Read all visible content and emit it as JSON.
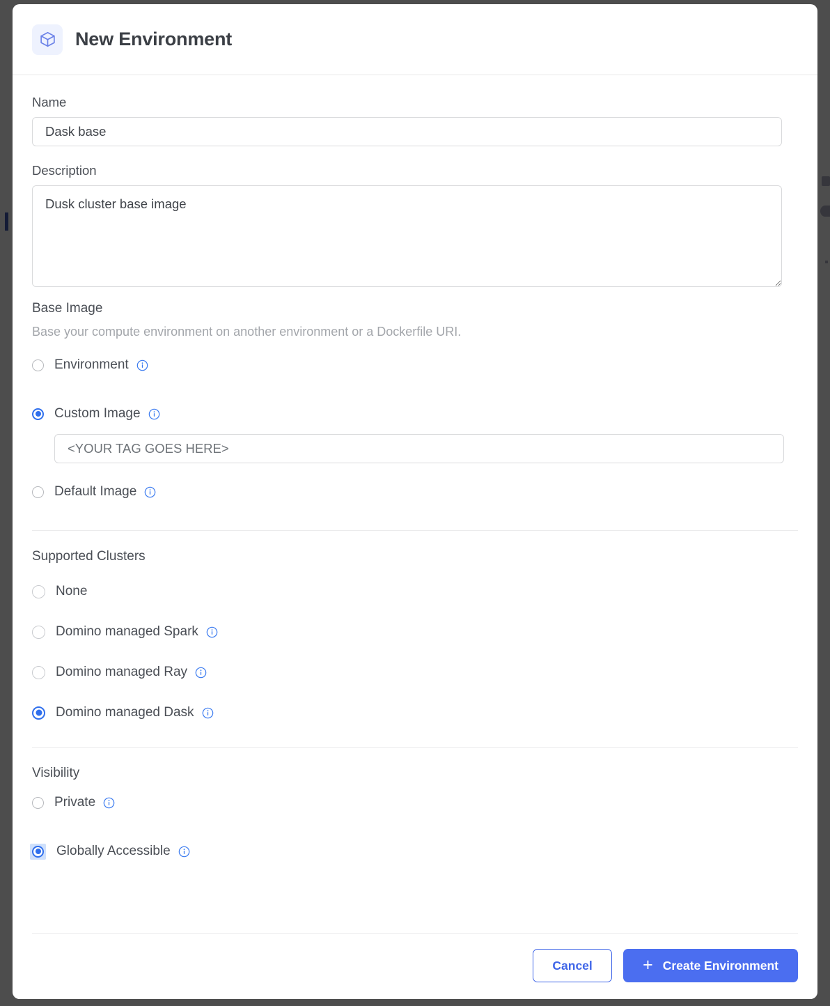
{
  "header": {
    "icon": "cube-icon",
    "title": "New Environment"
  },
  "colors": {
    "accent_blue": "#2f6fed",
    "primary_button": "#4b6ef0",
    "cancel_border": "#4066e8",
    "icon_tile_bg": "#eef2fe",
    "cube_icon": "#6b82e8",
    "label_text": "#4a4e55",
    "help_text": "#a3a6ab",
    "radio_focus_bg": "#cfe0fb",
    "page_backdrop": "#4d4d4d"
  },
  "fields": {
    "name": {
      "label": "Name",
      "value": "Dask base",
      "placeholder": ""
    },
    "description": {
      "label": "Description",
      "value": "Dusk cluster base image",
      "placeholder": ""
    }
  },
  "base_image": {
    "title": "Base Image",
    "help": "Base your compute environment on another environment or a Dockerfile URI.",
    "options": [
      {
        "label": "Environment",
        "selected": false,
        "has_info": true
      },
      {
        "label": "Custom Image",
        "selected": true,
        "has_info": true
      },
      {
        "label": "Default Image",
        "selected": false,
        "has_info": true
      }
    ],
    "custom_image_input": {
      "value": "",
      "placeholder": "<YOUR TAG GOES HERE>"
    }
  },
  "supported_clusters": {
    "title": "Supported Clusters",
    "options": [
      {
        "label": "None",
        "selected": false,
        "has_info": false
      },
      {
        "label": "Domino managed Spark",
        "selected": false,
        "has_info": true
      },
      {
        "label": "Domino managed Ray",
        "selected": false,
        "has_info": true
      },
      {
        "label": "Domino managed Dask",
        "selected": true,
        "has_info": true
      }
    ]
  },
  "visibility": {
    "title": "Visibility",
    "options": [
      {
        "label": "Private",
        "selected": false,
        "has_info": true,
        "focused": false
      },
      {
        "label": "Globally Accessible",
        "selected": true,
        "has_info": true,
        "focused": true
      }
    ]
  },
  "footer": {
    "cancel_label": "Cancel",
    "create_label": "Create Environment",
    "create_icon": "plus-icon"
  }
}
